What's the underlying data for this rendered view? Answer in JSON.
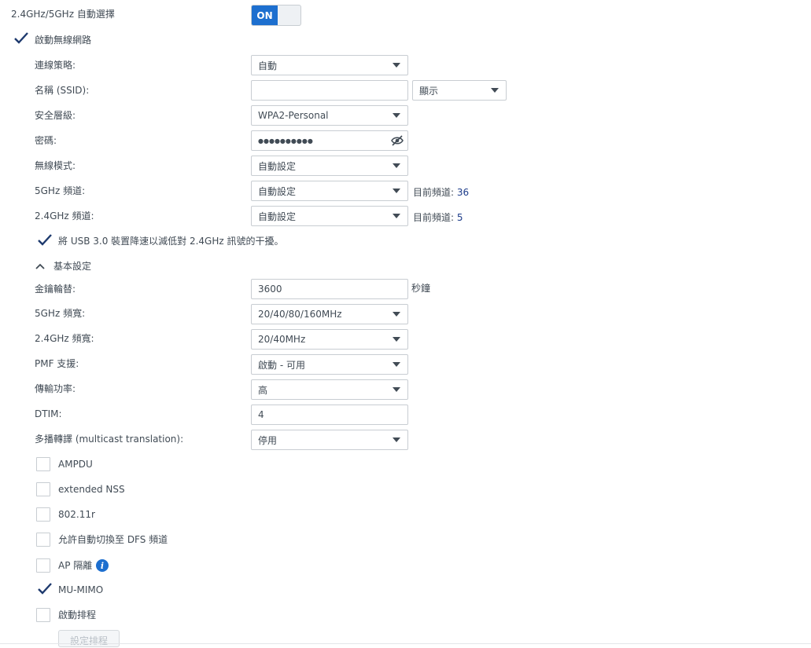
{
  "band_auto": {
    "label": "2.4GHz/5GHz 自動選擇",
    "toggle_label": "ON"
  },
  "enable_wireless": {
    "label": "啟動無線網路",
    "checked": true
  },
  "form": {
    "strategy": {
      "label": "連線策略:",
      "value": "自動"
    },
    "ssid": {
      "label": "名稱 (SSID):",
      "value": "",
      "visibility": "顯示"
    },
    "security": {
      "label": "安全層級:",
      "value": "WPA2-Personal"
    },
    "password": {
      "label": "密碼:",
      "value": "●●●●●●●●●●"
    },
    "wireless_mode": {
      "label": "無線模式:",
      "value": "自動設定"
    },
    "ch5": {
      "label": "5GHz 頻道:",
      "value": "自動設定",
      "current_label": "目前頻道:",
      "current_value": "36"
    },
    "ch24": {
      "label": "2.4GHz 頻道:",
      "value": "自動設定",
      "current_label": "目前頻道:",
      "current_value": "5"
    }
  },
  "usb": {
    "label": "將 USB 3.0 裝置降速以減低對 2.4GHz 訊號的干擾。",
    "checked": true
  },
  "basic": {
    "label": "基本設定"
  },
  "adv": {
    "key_rotation": {
      "label": "金鑰輪替:",
      "value": "3600",
      "unit": "秒鐘"
    },
    "bw5": {
      "label": "5GHz 頻寬:",
      "value": "20/40/80/160MHz"
    },
    "bw24": {
      "label": "2.4GHz 頻寬:",
      "value": "20/40MHz"
    },
    "pmf": {
      "label": "PMF 支援:",
      "value": "啟動 - 可用"
    },
    "power": {
      "label": "傳輸功率:",
      "value": "高"
    },
    "dtim": {
      "label": "DTIM:",
      "value": "4"
    },
    "multicast": {
      "label": "多播轉譯 (multicast translation):",
      "value": "停用"
    }
  },
  "options": [
    {
      "label": "AMPDU",
      "checked": false
    },
    {
      "label": "extended NSS",
      "checked": false
    },
    {
      "label": "802.11r",
      "checked": false
    },
    {
      "label": "允許自動切換至 DFS 頻道",
      "checked": false
    },
    {
      "label": "AP 隔離",
      "checked": false
    },
    {
      "label": "MU-MIMO",
      "checked": true
    },
    {
      "label": "啟動排程",
      "checked": false
    }
  ],
  "schedule_button": {
    "label": "設定排程"
  },
  "colors": {
    "accent": "#1d6fcf",
    "text": "#414b55",
    "border": "#c8cdd2",
    "value_blue": "#1d3c8a"
  }
}
